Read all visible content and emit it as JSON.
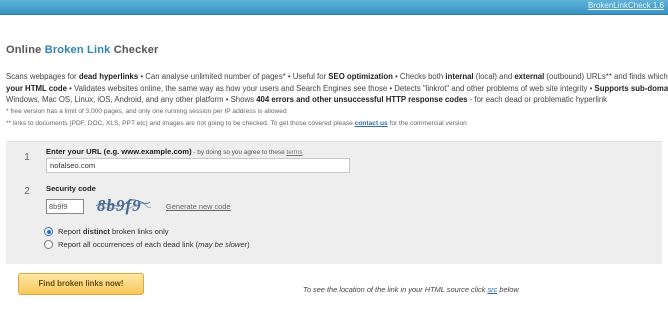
{
  "topbar": {
    "link": "BrokenLinkCheck 1.6"
  },
  "page": {
    "title_pre": "Online ",
    "title_hl": "Broken Link",
    "title_post": " Checker"
  },
  "intro": {
    "l1_a": "Scans webpages for ",
    "l1_b": "dead hyperlinks",
    "l1_c": " • Can analyse unlimited number of pages* • Useful for ",
    "l1_d": "SEO optimization",
    "l1_e": " • Checks both ",
    "l1_f": "internal",
    "l1_g": " (local) and ",
    "l1_h": "external",
    "l1_i": " (outbound) URLs** and finds which and",
    "l2_a": "your HTML code",
    "l2_b": " • Validates websites online, the same way as how your users and Search Engines see those • Detects \"linkrot\" and other problems of web site integrity • ",
    "l2_c": "Supports sub-domains",
    "l3_a": "Windows, Mac OS, Linux, iOS, Android, and any other platform • Shows ",
    "l3_b": "404 errors and other unsuccessful HTTP response codes",
    "l3_c": " - for each dead or problematic hyperlink"
  },
  "notes": {
    "n1": "* free version has a limit of 3,000 pages, and only one running session per IP address is allowed",
    "n2_a": "** links to documents (PDF, DOC, XLS, PPT etc) and images are not going to be checked. To get those covered please ",
    "n2_link": "contact us",
    "n2_b": " for the commercial version"
  },
  "form": {
    "step1": "1",
    "url_label_a": "Enter your URL (e.g. ",
    "url_label_example": "www.example.com",
    "url_label_b": ")",
    "url_label_small": " - by doing so you agree to these ",
    "url_label_terms": "terms",
    "url_value": "nofalseo.com",
    "step2": "2",
    "code_label": "Security code",
    "code_value": "8b9f9",
    "captcha_text": "8b9f9",
    "gen_link": "Generate new code",
    "radio1_a": "Report ",
    "radio1_b": "distinct",
    "radio1_c": " broken links only",
    "radio2_a": "Report all occurrences of each dead link (",
    "radio2_b": "may be slower",
    "radio2_c": ")"
  },
  "actions": {
    "find": "Find broken links now!",
    "hint_a": "To see the location of the link in your HTML source click ",
    "hint_src": "src",
    "hint_b": " below"
  },
  "colors": {
    "accent": "#2e84b6",
    "button": "#f7c85a",
    "panel": "#eeeeee"
  }
}
